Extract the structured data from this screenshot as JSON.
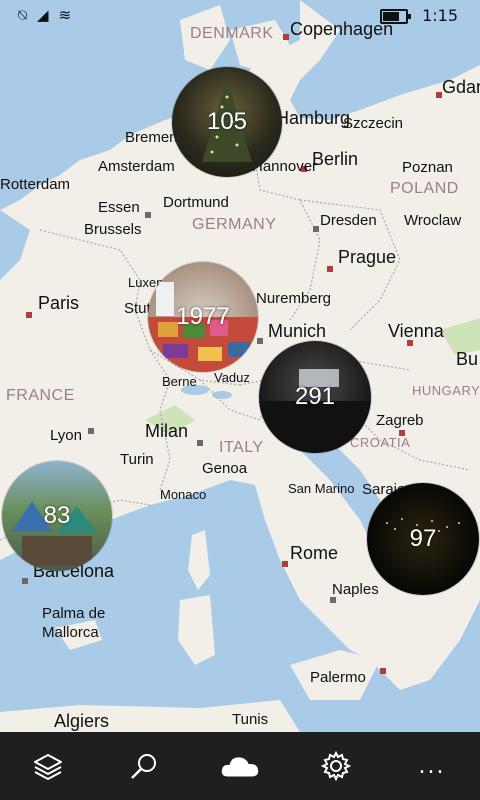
{
  "status_bar": {
    "time": "1:15"
  },
  "map": {
    "cities": [
      {
        "name": "Copenhagen"
      },
      {
        "name": "Gdan"
      },
      {
        "name": "Hamburg"
      },
      {
        "name": "Szczecin"
      },
      {
        "name": "Bremen"
      },
      {
        "name": "Amsterdam"
      },
      {
        "name": "Hannover"
      },
      {
        "name": "Berlin"
      },
      {
        "name": "Poznan"
      },
      {
        "name": "Rotterdam"
      },
      {
        "name": "Essen"
      },
      {
        "name": "Dortmund"
      },
      {
        "name": "Dresden"
      },
      {
        "name": "Wroclaw"
      },
      {
        "name": "Brussels"
      },
      {
        "name": "Prague"
      },
      {
        "name": "Paris"
      },
      {
        "name": "Luxembourg"
      },
      {
        "name": "Stuttgart"
      },
      {
        "name": "Nuremberg"
      },
      {
        "name": "Munich"
      },
      {
        "name": "Vienna"
      },
      {
        "name": "Bu"
      },
      {
        "name": "Berne"
      },
      {
        "name": "Vaduz"
      },
      {
        "name": "Zagreb"
      },
      {
        "name": "Lyon"
      },
      {
        "name": "Milan"
      },
      {
        "name": "Turin"
      },
      {
        "name": "Genoa"
      },
      {
        "name": "Monaco"
      },
      {
        "name": "San Marino"
      },
      {
        "name": "Sarajevo"
      },
      {
        "name": "Rome"
      },
      {
        "name": "Barcelona"
      },
      {
        "name": "Naples"
      },
      {
        "name": "Palma de"
      },
      {
        "name": "Mallorca"
      },
      {
        "name": "Palermo"
      },
      {
        "name": "Algiers"
      },
      {
        "name": "Tunis"
      }
    ],
    "countries": [
      {
        "name": "DENMARK"
      },
      {
        "name": "GERMANY"
      },
      {
        "name": "POLAND"
      },
      {
        "name": "FRANCE"
      },
      {
        "name": "HUNGARY"
      },
      {
        "name": "ITALY"
      },
      {
        "name": "CROATIA"
      }
    ]
  },
  "photo_clusters": [
    {
      "count": "105",
      "label": "Christmas tree photo cluster"
    },
    {
      "count": "1977",
      "label": "Tea boxes photo cluster"
    },
    {
      "count": "291",
      "label": "Conference hall photo cluster"
    },
    {
      "count": "83",
      "label": "Campsite photo cluster"
    },
    {
      "count": "97",
      "label": "Night city photo cluster"
    }
  ],
  "app_bar": {
    "buttons": [
      {
        "icon": "layers-icon"
      },
      {
        "icon": "search-icon"
      },
      {
        "icon": "onedrive-cloud-icon"
      },
      {
        "icon": "settings-gear-icon"
      },
      {
        "icon": "more-ellipsis-icon"
      }
    ],
    "more_label": "..."
  },
  "colors": {
    "water": "#a9cbe8",
    "land": "#f2efe9",
    "appbar": "#1f1f1f",
    "city_dot": "#b33c3c"
  }
}
